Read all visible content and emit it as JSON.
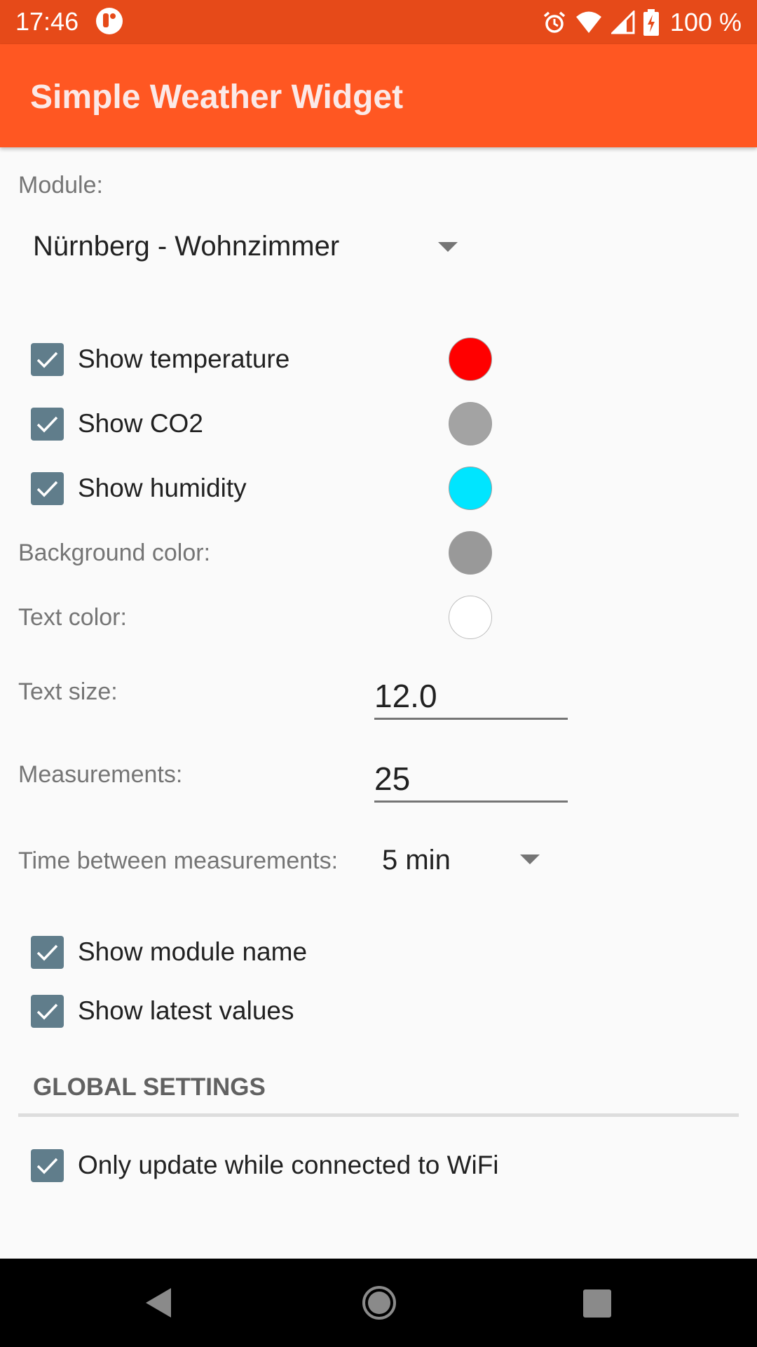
{
  "status_bar": {
    "time": "17:46",
    "battery_text": "100 %",
    "icons": [
      "app-notification-icon",
      "alarm-icon",
      "wifi-icon",
      "cell-signal-icon",
      "battery-charging-icon"
    ]
  },
  "app_bar": {
    "title": "Simple Weather Widget",
    "color": "#ff5722",
    "status_color": "#e64a19"
  },
  "module": {
    "label": "Module:",
    "selected": "Nürnberg - Wohnzimmer"
  },
  "series": [
    {
      "label": "Show temperature",
      "checked": true,
      "color": "#ff0000"
    },
    {
      "label": "Show CO2",
      "checked": true,
      "color": "#a3a3a3"
    },
    {
      "label": "Show humidity",
      "checked": true,
      "color": "#00e5ff"
    }
  ],
  "background_color": {
    "label": "Background color:",
    "color": "#999999"
  },
  "text_color": {
    "label": "Text color:",
    "color": "#ffffff"
  },
  "text_size": {
    "label": "Text size:",
    "value": "12.0"
  },
  "measurements": {
    "label": "Measurements:",
    "value": "25"
  },
  "interval": {
    "label": "Time between measurements:",
    "selected": "5 min"
  },
  "display_options": [
    {
      "label": "Show module name",
      "checked": true
    },
    {
      "label": "Show latest values",
      "checked": true
    }
  ],
  "global_settings": {
    "header": "GLOBAL SETTINGS",
    "options": [
      {
        "label": "Only update while connected to WiFi",
        "checked": true
      }
    ]
  },
  "checkbox_color": "#607d8b"
}
